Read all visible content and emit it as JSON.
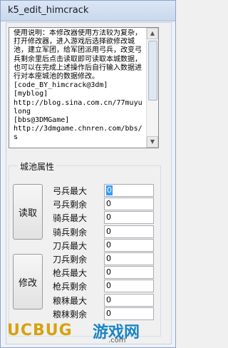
{
  "window": {
    "title": "k5_edit_himcrack"
  },
  "memo": {
    "text": "使用说明：本修改器使用方法较为复杂，打开修改器，进入游戏后选择欲修改城池，建立军团，给军团派用弓兵，改变弓兵剩余里后点击读取即可读取本城数据，也可以在完成上述操作后自行输入数据进行对本座城池的数据修改。\n[code_BY_himcrack@3dm]\n[myblog]\nhttp://blog.sina.com.cn/77muyulong\n[bbs@3DMGame]\nhttp://3dmgame.chnren.com/bbs/s"
  },
  "group": {
    "title": "城池属性"
  },
  "buttons": {
    "read": "读取",
    "modify": "修改"
  },
  "fields": [
    {
      "label": "弓兵最大",
      "value": "0",
      "selected": true
    },
    {
      "label": "弓兵剩余",
      "value": "0"
    },
    {
      "label": "骑兵最大",
      "value": "0"
    },
    {
      "label": "骑兵剩余",
      "value": "0"
    },
    {
      "label": "刀兵最大",
      "value": "0"
    },
    {
      "label": "刀兵剩余",
      "value": "0"
    },
    {
      "label": "枪兵最大",
      "value": "0"
    },
    {
      "label": "枪兵剩余",
      "value": "0"
    },
    {
      "label": "粮秣最大",
      "value": "0"
    },
    {
      "label": "粮秣剩余",
      "value": "0"
    }
  ],
  "watermark": {
    "brand_a": "UC",
    "brand_b": "BUG",
    "site_cn": "游戏网",
    "site_url": ".com"
  }
}
